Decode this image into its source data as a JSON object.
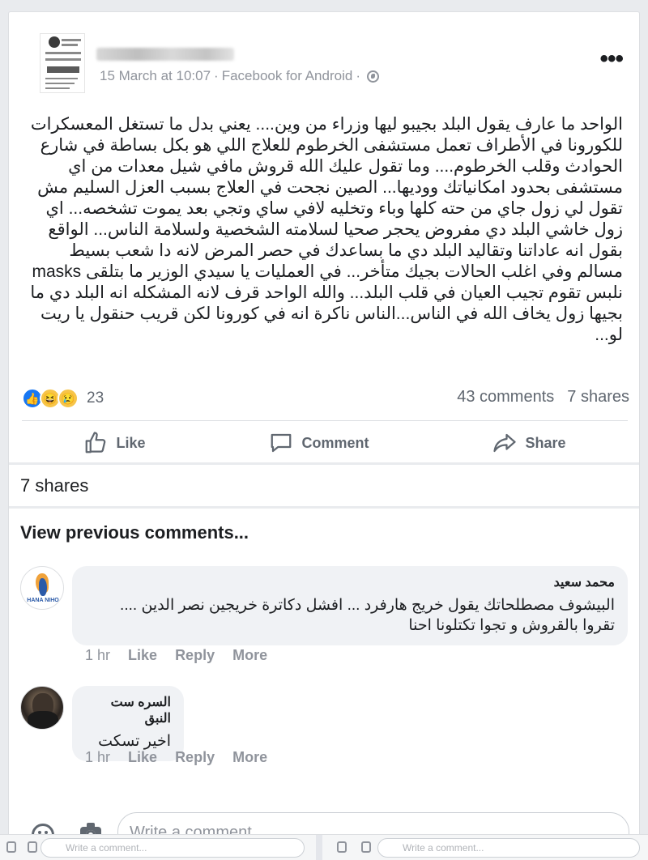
{
  "post": {
    "timestamp": "15 March at 10:07",
    "source": "Facebook for Android",
    "separator": "·",
    "more_label": "•••",
    "text": "الواحد ما عارف يقول البلد بجيبو ليها وزراء من وين.... يعني بدل ما تستغل المعسكرات للكورونا في الأطراف تعمل مستشفى الخرطوم للعلاج اللي هو بكل بساطة في شارع الحوادث وقلب الخرطوم.... وما تقول عليك الله قروش مافي شيل معدات من اي مستشفى بحدود امكانياتك ووديها... الصين نجحت في العلاج بسبب العزل السليم مش تقول لي زول جاي من حته كلها وباء وتخليه لافي ساي وتجي بعد يموت تشخصه... اي زول خاشي البلد دي مفروض يحجر صحيا لسلامته الشخصية ولسلامة الناس... الواقع بقول انه عاداتنا وتقاليد البلد دي ما بساعدك في حصر المرض لانه دا شعب بسيط مسالم وفي اغلب الحالات بجيك متأخر... في العمليات يا سيدي الوزير ما بتلقى masks نلبس تقوم تجيب العيان في قلب البلد... والله الواحد قرف لانه المشكله انه البلد دي ما بجيها زول يخاف الله في الناس...الناس ناكرة انه في كورونا لكن قريب حنقول يا ريت لو..."
  },
  "reactions": {
    "count": "23",
    "comments": "43 comments",
    "shares": "7 shares",
    "icons": [
      "like-icon",
      "haha-icon",
      "sad-icon"
    ]
  },
  "actions": {
    "like": "Like",
    "comment": "Comment",
    "share": "Share"
  },
  "shares_line": "7 shares",
  "view_previous": "View previous comments...",
  "comments": [
    {
      "name": "محمد سعيد",
      "text": "البيشوف مصطلحاتك يقول خريج هارفرد ... افشل دكاترة خريجين نصر الدين .... تقروا بالقروش و تجوا تكتلونا احنا",
      "avatar_brand": "HANA NIHO",
      "time": "1 hr",
      "like": "Like",
      "reply": "Reply",
      "more": "More"
    },
    {
      "name": "السره ست النبق",
      "text": "اخير تسكت",
      "time": "1 hr",
      "like": "Like",
      "reply": "Reply",
      "more": "More"
    }
  ],
  "composer": {
    "placeholder": "Write a comment..."
  },
  "bottom_strip": {
    "placeholder_left": "Write a comment...",
    "placeholder_right": "Write a comment..."
  },
  "colors": {
    "accent": "#1877f2",
    "muted": "#90949c",
    "bubble": "#f0f2f5"
  }
}
